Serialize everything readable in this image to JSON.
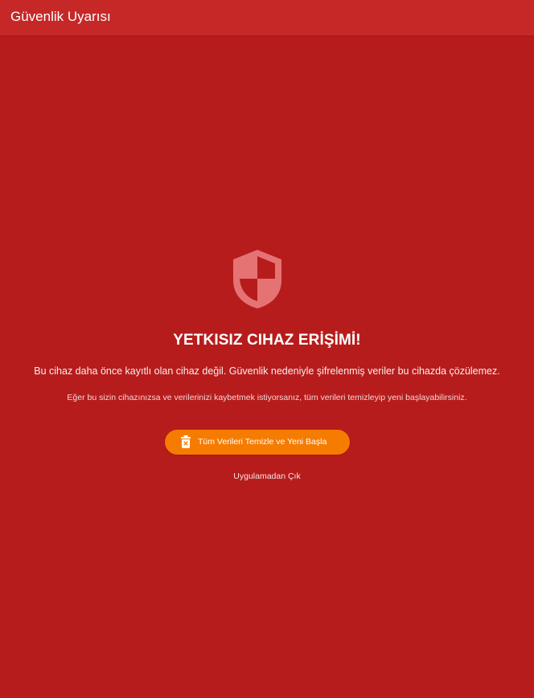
{
  "appbar": {
    "title": "Güvenlik Uyarısı"
  },
  "alert": {
    "icon": "shield-icon",
    "headline": "YETKISIZ CIHAZ ERİŞİMİ!",
    "message": "Bu cihaz daha önce kayıtlı olan cihaz değil. Güvenlik nedeniyle şifrelenmiş veriler bu cihazda çözülemez.",
    "hint": "Eğer bu sizin cihazınızsa ve verilerinizi kaybetmek istiyorsanız, tüm verileri temizleyip yeni başlayabilirsiniz."
  },
  "actions": {
    "reset_label": "Tüm Verileri Temizle ve Yeni Başla",
    "reset_icon": "delete-icon",
    "exit_label": "Uygulamadan Çık"
  },
  "colors": {
    "background": "#b71c1c",
    "appbar": "#c62828",
    "button": "#f57c00",
    "shield_light": "#e57373",
    "shield_dark": "#b71c1c"
  }
}
